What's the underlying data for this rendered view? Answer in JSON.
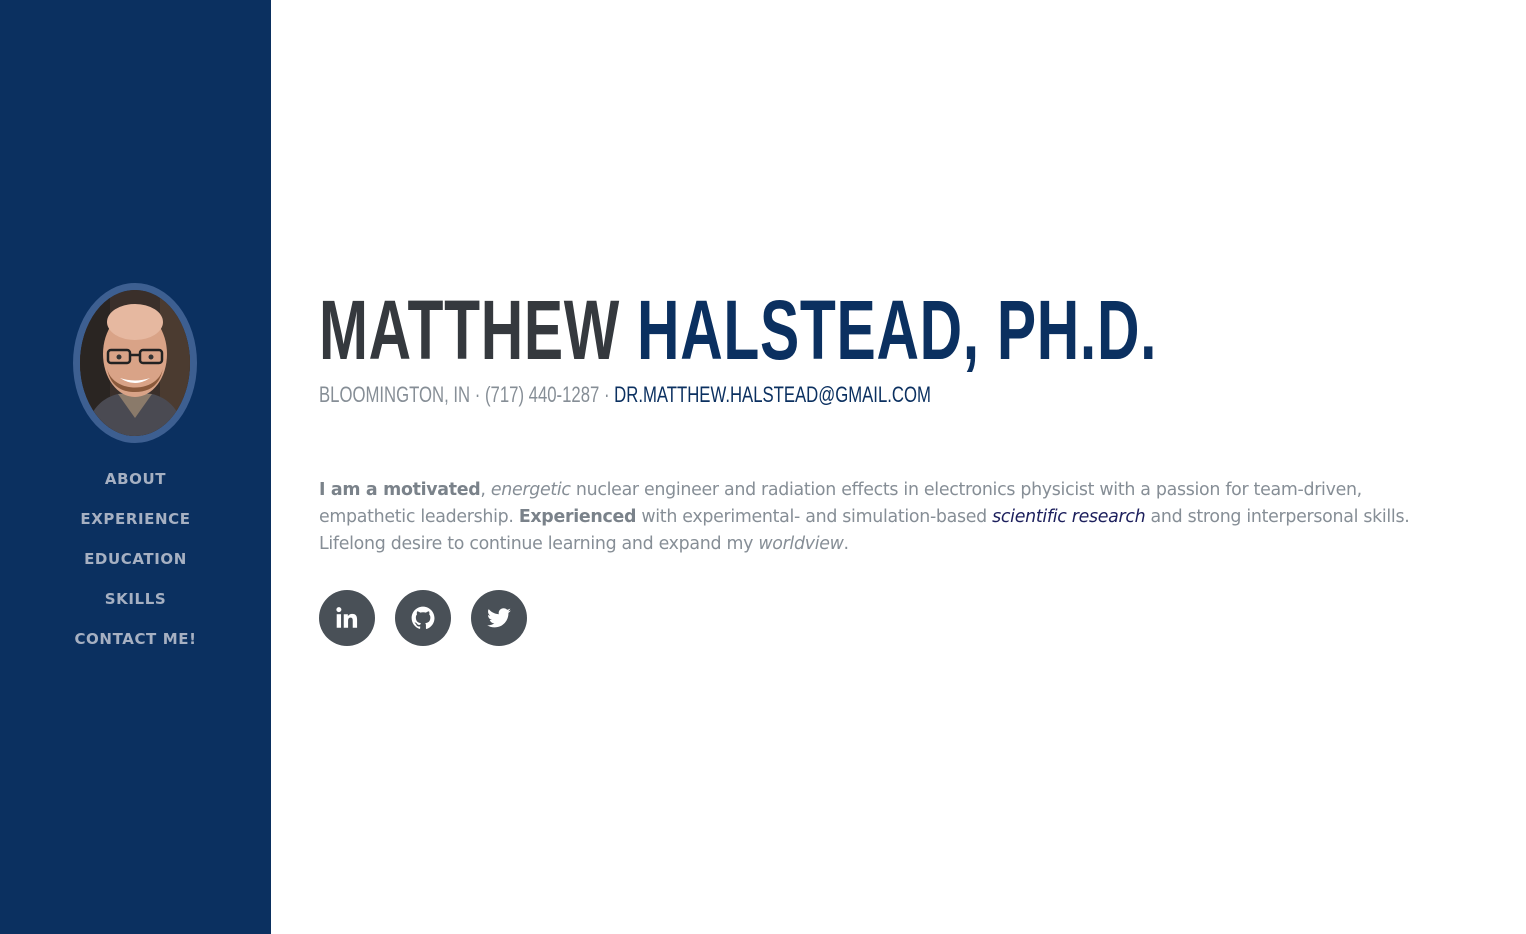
{
  "sidebar": {
    "avatar_alt": "profile photo",
    "nav": [
      {
        "label": "ABOUT"
      },
      {
        "label": "EXPERIENCE"
      },
      {
        "label": "EDUCATION"
      },
      {
        "label": "SKILLS"
      },
      {
        "label": "CONTACT ME!"
      }
    ]
  },
  "header": {
    "first_name": "MATTHEW",
    "last_name": "HALSTEAD, PH.D."
  },
  "subheading": {
    "location": "BLOOMINGTON, IN · (717) 440-1287 · ",
    "email": "DR.MATTHEW.HALSTEAD@GMAIL.COM"
  },
  "lead": {
    "p1": "I am a motivated",
    "p2": ", ",
    "p3": "energetic",
    "p4": " nuclear engineer and radiation effects in electronics physicist with a passion for team-driven, empathetic leadership. ",
    "p5": "Experienced",
    "p6": " with experimental- and simulation-based ",
    "p7": "scientific research",
    "p8": " and strong interpersonal skills. Lifelong desire to continue learning and expand my ",
    "p9": "worldview",
    "p10": "."
  },
  "social": {
    "icons": [
      "linkedin-icon",
      "github-icon",
      "twitter-icon"
    ]
  },
  "colors": {
    "sidebar_bg": "#0b3060",
    "accent": "#0b3060",
    "text_dark": "#35393e",
    "text_muted": "#868e96",
    "social_bg": "#495057"
  }
}
